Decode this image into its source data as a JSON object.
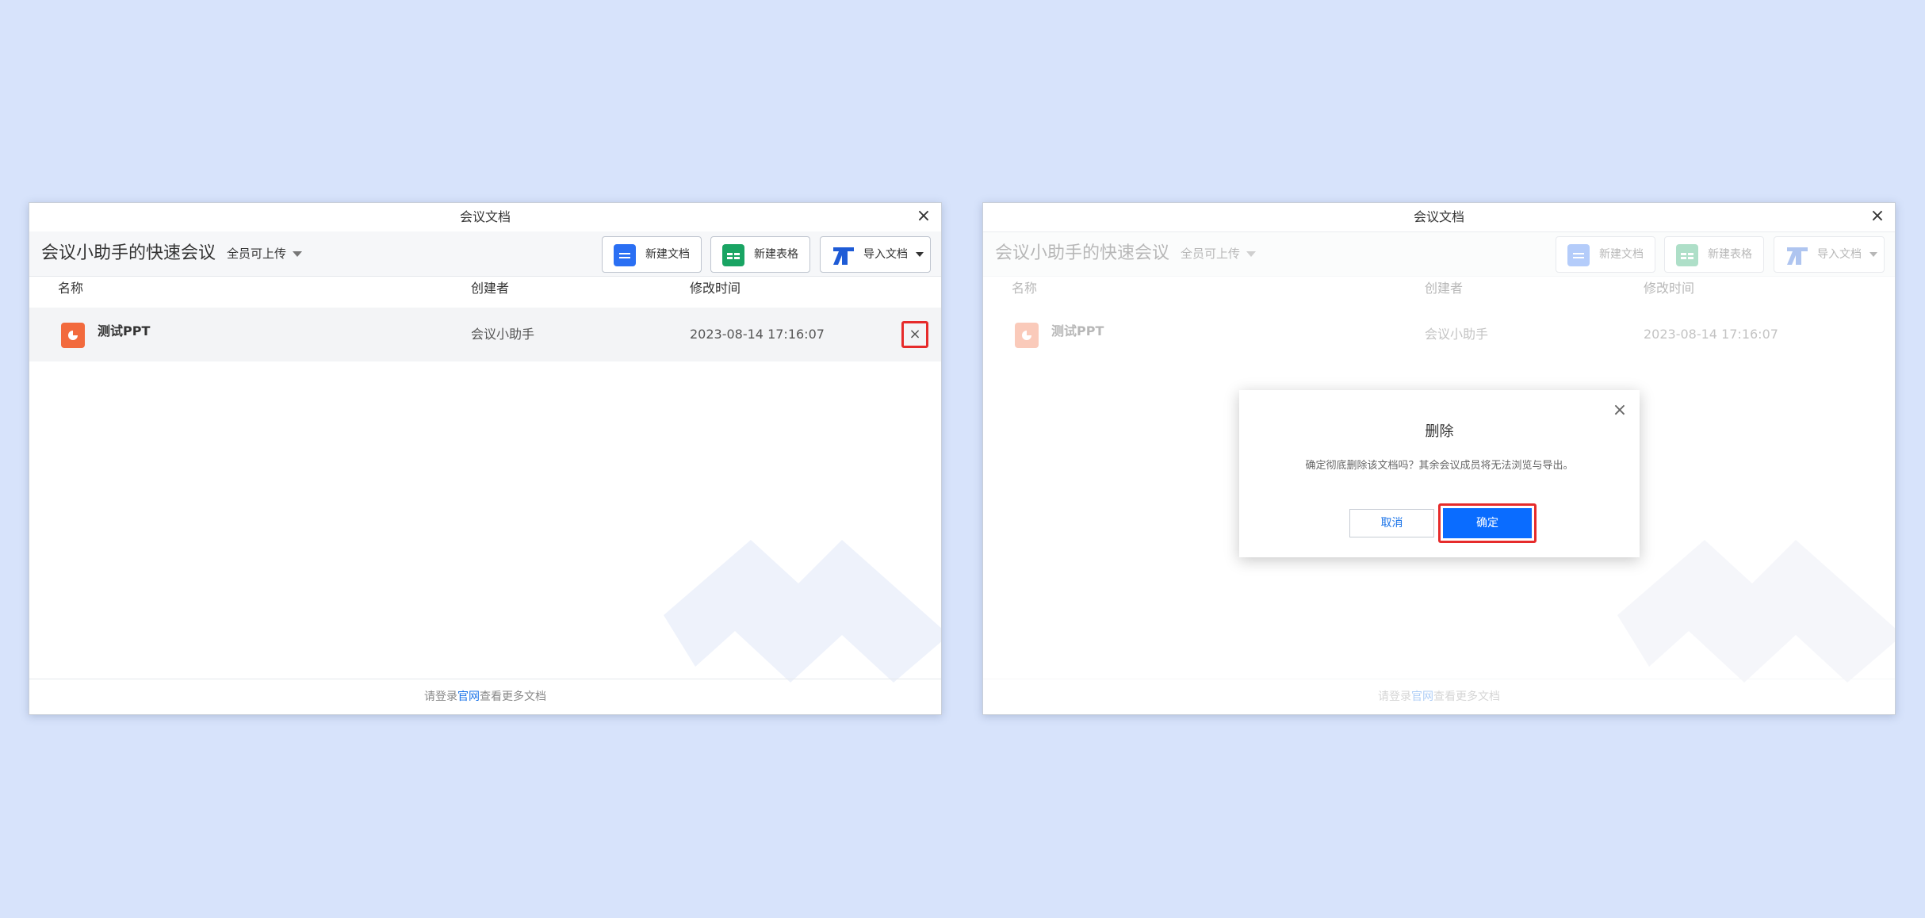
{
  "window_title": "会议文档",
  "meeting_title": "会议小助手的快速会议",
  "upload_scope": "全员可上传",
  "buttons": {
    "new_doc": "新建文档",
    "new_sheet": "新建表格",
    "import_doc": "导入文档"
  },
  "columns": {
    "name": "名称",
    "creator": "创建者",
    "modified": "修改时间"
  },
  "file": {
    "name": "测试PPT",
    "creator": "会议小助手",
    "modified": "2023-08-14 17:16:07",
    "delete_glyph": "×"
  },
  "footer": {
    "prefix": "请登录",
    "link": "官网",
    "suffix": "查看更多文档"
  },
  "dialog": {
    "title": "删除",
    "message": "确定彻底删除该文档吗？其余会议成员将无法浏览与导出。",
    "cancel": "取消",
    "confirm": "确定"
  },
  "icons": {
    "close": "×"
  },
  "colors": {
    "background": "#d7e3fb",
    "accent": "#0a6cff",
    "highlight": "#e62b2b",
    "ppt": "#f26a3d",
    "sheet": "#19a463",
    "doc": "#2a6ff3"
  }
}
